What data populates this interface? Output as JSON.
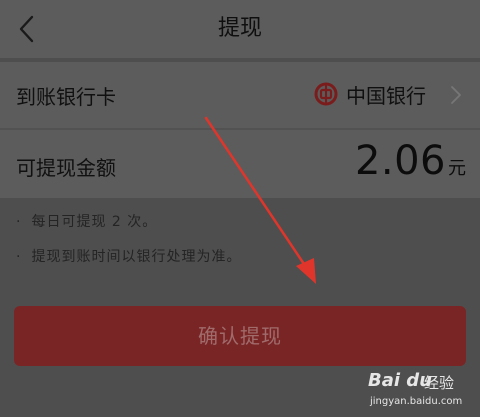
{
  "header": {
    "title": "提现",
    "back_icon": "back-chevron-icon"
  },
  "bank_row": {
    "label": "到账银行卡",
    "bank_name": "中国银行",
    "logo_icon": "bank-of-china-logo-icon",
    "chevron_icon": "chevron-right-icon"
  },
  "amount_row": {
    "label": "可提现金额",
    "amount": "2.06",
    "unit": "元"
  },
  "notes": [
    {
      "bullet": "·",
      "text": "每日可提现 2 次。"
    },
    {
      "bullet": "·",
      "text": "提现到账时间以银行处理为准。"
    }
  ],
  "confirm_button": {
    "label": "确认提现"
  },
  "watermark": {
    "logo": "Bai  du",
    "name": "经验",
    "url": "jingyan.baidu.com"
  },
  "colors": {
    "accent_red": "#7a2525",
    "annotation_arrow": "#e0352b"
  }
}
